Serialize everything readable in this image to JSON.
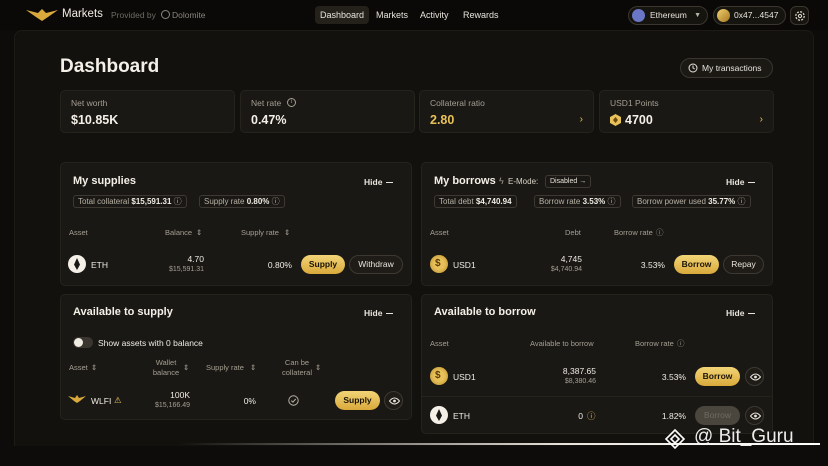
{
  "header": {
    "brand": "Markets",
    "provided_by": "Provided by",
    "provider": "Dolomite",
    "nav": [
      "Dashboard",
      "Markets",
      "Activity",
      "Rewards"
    ],
    "network": "Ethereum",
    "wallet": "0x47...4547"
  },
  "page": {
    "title": "Dashboard",
    "my_transactions": "My transactions"
  },
  "stats": [
    {
      "label": "Net worth",
      "value": "$10.85K"
    },
    {
      "label": "Net rate",
      "value": "0.47%"
    },
    {
      "label": "Collateral ratio",
      "value": "2.80"
    },
    {
      "label": "USD1 Points",
      "value": "4700"
    }
  ],
  "supplies": {
    "title": "My supplies",
    "hide": "Hide",
    "total_collateral_label": "Total collateral",
    "total_collateral": "$15,591.31",
    "supply_rate_label": "Supply rate",
    "supply_rate": "0.80%",
    "cols": [
      "Asset",
      "Balance",
      "Supply rate"
    ],
    "row": {
      "asset": "ETH",
      "balance": "4.70",
      "balance_usd": "$15,591.31",
      "rate": "0.80%",
      "btn1": "Supply",
      "btn2": "Withdraw"
    }
  },
  "borrows": {
    "title": "My borrows",
    "emode_label": "E-Mode:",
    "emode_value": "Disabled",
    "hide": "Hide",
    "total_debt_label": "Total debt",
    "total_debt": "$4,740.94",
    "borrow_rate_label": "Borrow rate",
    "borrow_rate": "3.53%",
    "power_label": "Borrow power used",
    "power": "35.77%",
    "cols": [
      "Asset",
      "Debt",
      "Borrow rate"
    ],
    "row": {
      "asset": "USD1",
      "debt": "4,745",
      "debt_usd": "$4,740.94",
      "rate": "3.53%",
      "btn1": "Borrow",
      "btn2": "Repay"
    }
  },
  "avail_supply": {
    "title": "Available to supply",
    "hide": "Hide",
    "toggle_label": "Show assets with 0 balance",
    "cols": [
      "Asset",
      "Wallet balance",
      "Supply rate",
      "Can be collateral"
    ],
    "row": {
      "asset": "WLFI",
      "balance": "100K",
      "balance_usd": "$15,166.49",
      "rate": "0%",
      "btn": "Supply"
    }
  },
  "avail_borrow": {
    "title": "Available to borrow",
    "hide": "Hide",
    "cols": [
      "Asset",
      "Available to borrow",
      "Borrow rate"
    ],
    "rows": [
      {
        "asset": "USD1",
        "avail": "8,387.65",
        "avail_usd": "$8,380.46",
        "rate": "3.53%",
        "btn": "Borrow"
      },
      {
        "asset": "ETH",
        "avail": "0",
        "rate": "1.82%",
        "btn": "Borrow"
      }
    ]
  },
  "watermark": "@ Bit_Guru",
  "colors": {
    "accent": "#e8c15a",
    "background": "#0d0c0a",
    "panel": "#1a1814"
  }
}
